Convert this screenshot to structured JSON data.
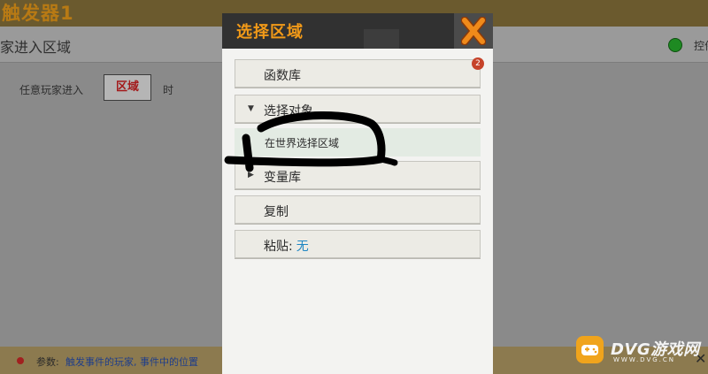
{
  "background": {
    "title": "触发器1",
    "header_left": "家进入区域",
    "header_right": "控件",
    "rule_prefix": "任意玩家进入",
    "area_button": "区域",
    "rule_suffix": "时",
    "footer_label": "参数:",
    "footer_value": "触发事件的玩家, 事件中的位置",
    "footer_close": "✕",
    "status_color": "#1e8a22"
  },
  "dialog": {
    "title": "选择区域",
    "close_icon": "close-x-icon",
    "items": [
      {
        "label": "函数库",
        "badge": "2"
      },
      {
        "label": "选择对象",
        "expanded": true,
        "caret": "▼"
      },
      {
        "label": "在世界选择区域"
      },
      {
        "label": "变量库",
        "caret": "▶"
      },
      {
        "label": "复制"
      },
      {
        "label": "粘贴:",
        "value": "无"
      }
    ]
  },
  "watermark": {
    "text": "DVG游戏网",
    "sub": "WWW.DVG.CN"
  },
  "colors": {
    "accent": "#f29a18",
    "dialog_header": "#313131",
    "paste_value": "#1e86c3"
  }
}
